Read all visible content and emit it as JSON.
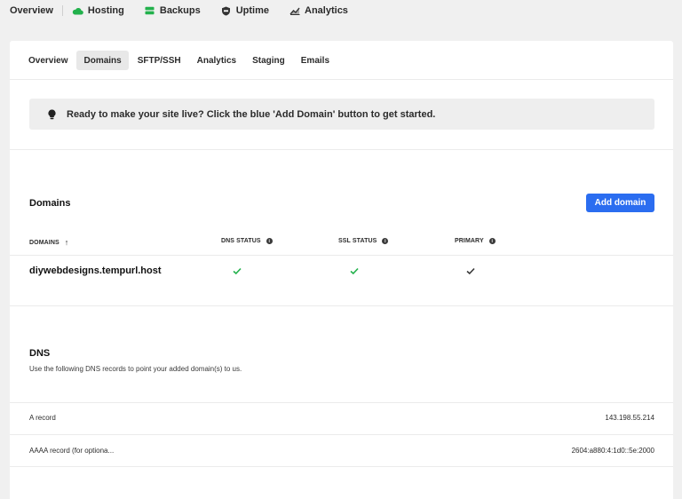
{
  "topnav": {
    "overview": "Overview",
    "hosting": "Hosting",
    "backups": "Backups",
    "uptime": "Uptime",
    "analytics": "Analytics"
  },
  "icons": {
    "hosting": "cloud-icon",
    "backups": "stack-icon",
    "uptime": "shield-icon",
    "analytics": "chart-icon",
    "notice": "lightbulb-icon"
  },
  "colors": {
    "hosting_icon": "#22b14c",
    "backups_icon": "#22b14c",
    "primary_button": "#2b6df0",
    "check_green": "#22b14c",
    "check_dark": "#3a3a3a"
  },
  "subtabs": [
    {
      "label": "Overview",
      "active": false
    },
    {
      "label": "Domains",
      "active": true
    },
    {
      "label": "SFTP/SSH",
      "active": false
    },
    {
      "label": "Analytics",
      "active": false
    },
    {
      "label": "Staging",
      "active": false
    },
    {
      "label": "Emails",
      "active": false
    }
  ],
  "notice": {
    "text": "Ready to make your site live? Click the blue 'Add Domain' button to get started."
  },
  "domains": {
    "title": "Domains",
    "add_button": "Add domain",
    "columns": {
      "domains": "DOMAINS",
      "dns_status": "DNS STATUS",
      "ssl_status": "SSL STATUS",
      "primary": "PRIMARY"
    },
    "rows": [
      {
        "domain": "diywebdesigns.tempurl.host",
        "dns_ok": true,
        "ssl_ok": true,
        "primary": true
      }
    ]
  },
  "dns": {
    "title": "DNS",
    "description": "Use the following DNS records to point your added domain(s) to us.",
    "records": [
      {
        "label": "A record",
        "value": "143.198.55.214"
      },
      {
        "label": "AAAA record (for optiona...",
        "value": "2604:a880:4:1d0::5e:2000"
      }
    ]
  }
}
